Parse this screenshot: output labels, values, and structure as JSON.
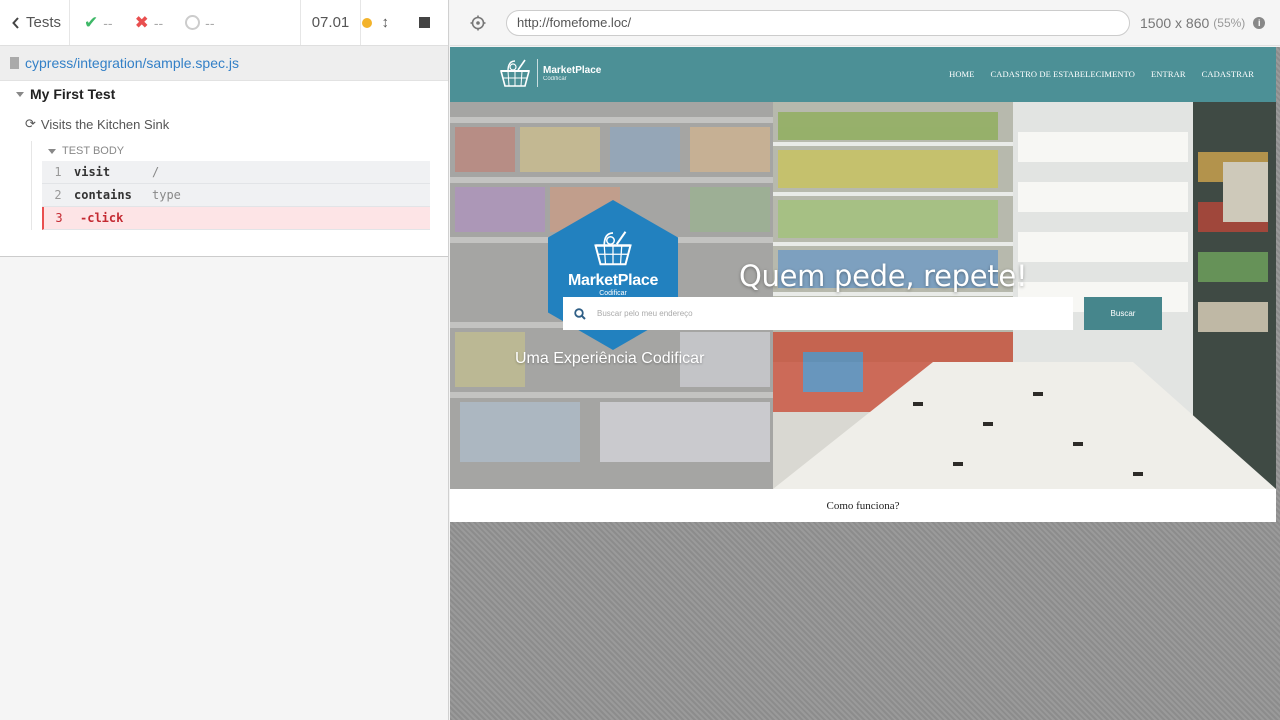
{
  "reporter": {
    "back_label": "Tests",
    "passed": "--",
    "failed": "--",
    "pending": "--",
    "duration": "07.01",
    "spec_path": "cypress/integration/sample.spec.js",
    "suite_title": "My First Test",
    "test_title": "Visits the Kitchen Sink",
    "test_body_label": "TEST BODY",
    "commands": [
      {
        "num": "1",
        "name": "visit",
        "arg": "/"
      },
      {
        "num": "2",
        "name": "contains",
        "arg": "type"
      },
      {
        "num": "3",
        "name": "-click",
        "arg": ""
      }
    ],
    "colors": {
      "pass": "#3eb867",
      "fail": "#e94f4f",
      "running": "#f3b32b",
      "link": "#3380c7"
    }
  },
  "aut": {
    "url": "http://fomefome.loc/",
    "viewport_size": "1500 x 860",
    "scale": "(55%)"
  },
  "site": {
    "logo_title": "MarketPlace",
    "logo_subtitle": "Codificar",
    "nav": [
      "HOME",
      "CADASTRO DE ESTABELECIMENTO",
      "ENTRAR",
      "CADASTRAR"
    ],
    "hex_title": "MarketPlace",
    "hex_subtitle": "Codificar",
    "slogan": "Quem pede, repete!",
    "search_placeholder": "Buscar pelo meu endereço",
    "search_button": "Buscar",
    "subtitle": "Uma Experiência Codificar",
    "how_it_works": "Como funciona?",
    "colors": {
      "navbar": "#4c9096",
      "hexagon": "#2281bf",
      "button": "#46868c"
    }
  }
}
